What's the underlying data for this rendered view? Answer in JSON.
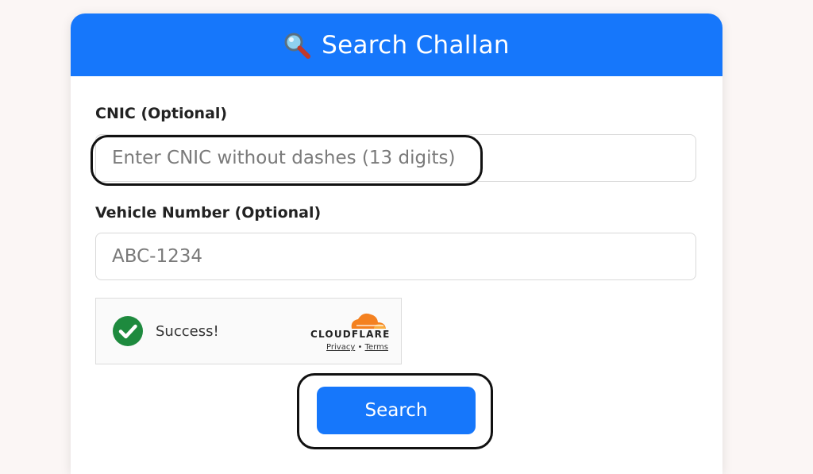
{
  "header": {
    "icon": "magnifying-glass-icon",
    "title": "Search Challan"
  },
  "form": {
    "cnic": {
      "label": "CNIC (Optional)",
      "placeholder": "Enter CNIC without dashes (13 digits)",
      "value": ""
    },
    "vehicle": {
      "label": "Vehicle Number (Optional)",
      "placeholder": "ABC-1234",
      "value": ""
    },
    "captcha": {
      "status": "Success!",
      "icon": "green-check-circle-icon",
      "brand": "CLOUDFLARE",
      "privacy_label": "Privacy",
      "separator": "•",
      "terms_label": "Terms"
    },
    "submit_label": "Search"
  },
  "colors": {
    "primary": "#1677fb",
    "success": "#1e8a3e",
    "cloudflare_orange": "#f48120",
    "highlight_outline": "#111111"
  }
}
